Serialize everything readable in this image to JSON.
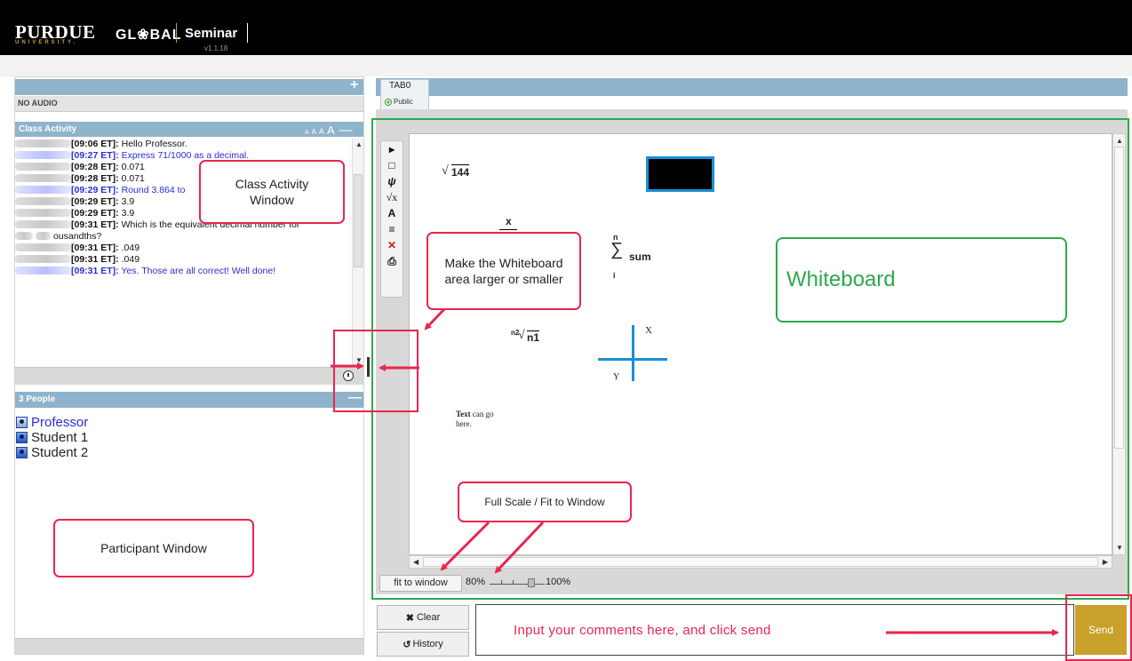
{
  "header": {
    "brand_purdue": "PURDUE",
    "brand_university": "UNIVERSITY.",
    "brand_global": "GL❀BAL",
    "app_name": "Seminar",
    "version": "v1.1.18"
  },
  "left_panel": {
    "audio": "NO AUDIO",
    "class_activity_title": "Class Activity",
    "font_size_controls": [
      "A",
      "A",
      "A",
      "A"
    ],
    "chat": [
      {
        "time": "[09:06 ET]:",
        "text": " Hello Professor.",
        "blue": false
      },
      {
        "time": "[09:27 ET]:",
        "text": " Express 71/1000 as a decimal.",
        "blue": true
      },
      {
        "time": "[09:28 ET]:",
        "text": " 0.071",
        "blue": false
      },
      {
        "time": "[09:28 ET]:",
        "text": " 0.071",
        "blue": false
      },
      {
        "time": "[09:29 ET]:",
        "text": " Round 3.864 to",
        "blue": true
      },
      {
        "time": "[09:29 ET]:",
        "text": " 3.9",
        "blue": false
      },
      {
        "time": "[09:29 ET]:",
        "text": " 3.9",
        "blue": false
      },
      {
        "time": "[09:31 ET]:",
        "text": " Which is the equivalent decimal number for",
        "blue": false
      },
      {
        "time": "",
        "text": "ousandths?",
        "blue": false
      },
      {
        "time": "[09:31 ET]:",
        "text": " .049",
        "blue": false
      },
      {
        "time": "[09:31 ET]:",
        "text": " .049",
        "blue": false
      },
      {
        "time": "[09:31 ET]:",
        "text": " Yes. Those are all correct! Well done!",
        "blue": true
      }
    ],
    "people_title": "3 People",
    "people": [
      {
        "name": "Professor",
        "role": "professor"
      },
      {
        "name": "Student 1",
        "role": "student"
      },
      {
        "name": "Student 2",
        "role": "student"
      }
    ]
  },
  "whiteboard": {
    "tab_label": "TAB0",
    "tab_visibility": "Public",
    "tools": [
      "pointer-icon",
      "rectangle-icon",
      "freehand-icon",
      "equation-icon",
      "text-icon",
      "layers-icon",
      "delete-icon",
      "print-icon"
    ],
    "tool_glyphs": [
      "▸",
      "□",
      "ψ",
      "√x",
      "A",
      "≡",
      "✕",
      "⎙"
    ],
    "content": {
      "sqrt_radicand": "144",
      "fraction_numerator": "x",
      "sum_upper": "n",
      "sum_body": "sum",
      "sum_lower": "i",
      "root_index": "n2",
      "root_radicand": "n1",
      "axis_x": "X",
      "axis_y": "Y",
      "text_bold": "Text",
      "text_rest": " can go",
      "text_line2": "here."
    },
    "fit_button": "fit to window",
    "zoom_min": "80%",
    "zoom_max": "100%",
    "zoom_level": 0.75
  },
  "bottom": {
    "clear_label": "Clear",
    "history_label": "History",
    "send_label": "Send",
    "comment_placeholder": ""
  },
  "annotations": {
    "class_activity": "Class Activity Window",
    "resize": "Make the Whiteboard area larger or smaller",
    "whiteboard": "Whiteboard",
    "full_scale": "Full Scale / Fit to Window",
    "participant": "Participant Window",
    "input_hint": "Input your comments here, and click send"
  },
  "colors": {
    "header_bg": "#000000",
    "panel_bar": "#8fb3cb",
    "accent_gold": "#c8a02a",
    "annotation_red": "#e8264e",
    "annotation_green": "#2ea84c",
    "chat_blue": "#2b2bd6"
  }
}
